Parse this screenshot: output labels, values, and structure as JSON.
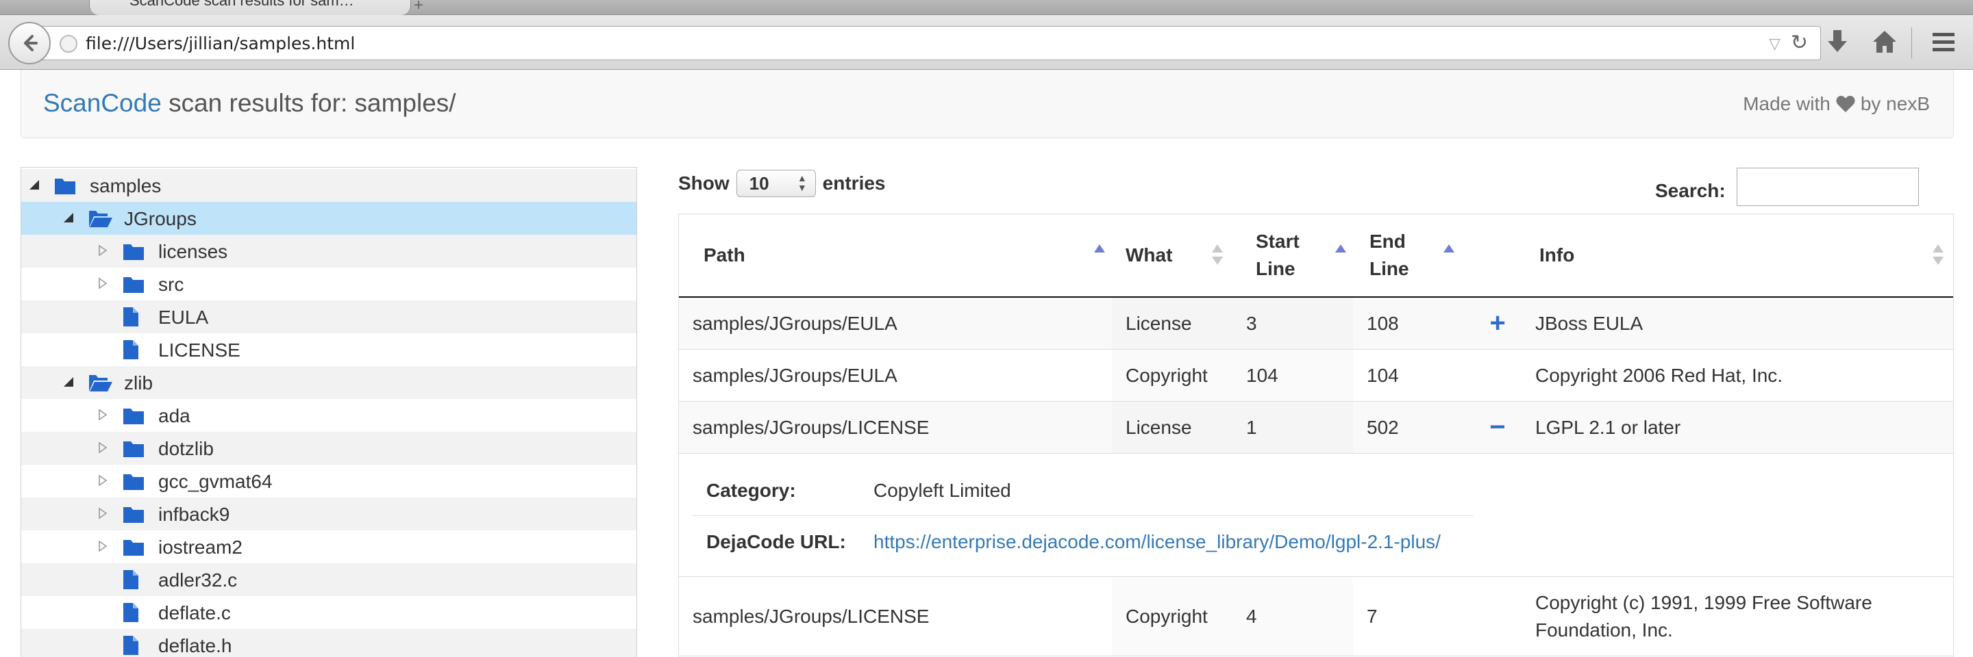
{
  "browser": {
    "tab_title": "ScanCode scan results for sam…",
    "url": "file:///Users/jillian/samples.html"
  },
  "header": {
    "brand": "ScanCode",
    "title_suffix": " scan results for: samples/",
    "made_with": "Made with",
    "by": "by nexB"
  },
  "tree": [
    {
      "label": "samples",
      "type": "folder",
      "expanded": true
    },
    {
      "label": "JGroups",
      "type": "folder-open",
      "expanded": true,
      "selected": true
    },
    {
      "label": "licenses",
      "type": "folder",
      "expanded": false
    },
    {
      "label": "src",
      "type": "folder",
      "expanded": false
    },
    {
      "label": "EULA",
      "type": "file"
    },
    {
      "label": "LICENSE",
      "type": "file"
    },
    {
      "label": "zlib",
      "type": "folder-open",
      "expanded": true
    },
    {
      "label": "ada",
      "type": "folder",
      "expanded": false
    },
    {
      "label": "dotzlib",
      "type": "folder",
      "expanded": false
    },
    {
      "label": "gcc_gvmat64",
      "type": "folder",
      "expanded": false
    },
    {
      "label": "infback9",
      "type": "folder",
      "expanded": false
    },
    {
      "label": "iostream2",
      "type": "folder",
      "expanded": false
    },
    {
      "label": "adler32.c",
      "type": "file"
    },
    {
      "label": "deflate.c",
      "type": "file"
    },
    {
      "label": "deflate.h",
      "type": "file"
    }
  ],
  "table": {
    "show_label": "Show",
    "entries_label": "entries",
    "page_size": "10",
    "search_label": "Search:",
    "columns": {
      "path": "Path",
      "what": "What",
      "start_line_1": "Start",
      "start_line_2": "Line",
      "end_line_1": "End",
      "end_line_2": "Line",
      "info": "Info"
    },
    "rows": [
      {
        "path": "samples/JGroups/EULA",
        "what": "License",
        "start": "3",
        "end": "108",
        "toggle": "+",
        "info": "JBoss EULA"
      },
      {
        "path": "samples/JGroups/EULA",
        "what": "Copyright",
        "start": "104",
        "end": "104",
        "toggle": "",
        "info": "Copyright 2006 Red Hat, Inc."
      },
      {
        "path": "samples/JGroups/LICENSE",
        "what": "License",
        "start": "1",
        "end": "502",
        "toggle": "−",
        "info": "LGPL 2.1 or later"
      },
      {
        "path": "samples/JGroups/LICENSE",
        "what": "Copyright",
        "start": "4",
        "end": "7",
        "toggle": "",
        "info": "Copyright (c) 1991, 1999 Free Software Foundation, Inc."
      }
    ],
    "detail": {
      "category_label": "Category:",
      "category_value": "Copyleft Limited",
      "url_label": "DejaCode URL:",
      "url_value": "https://enterprise.dejacode.com/license_library/Demo/lgpl-2.1-plus/"
    }
  },
  "colors": {
    "link": "#337ab7",
    "icon_blue": "#2266cc",
    "selected_row": "#bfe3f8",
    "sort_active": "#6f7fd6"
  }
}
